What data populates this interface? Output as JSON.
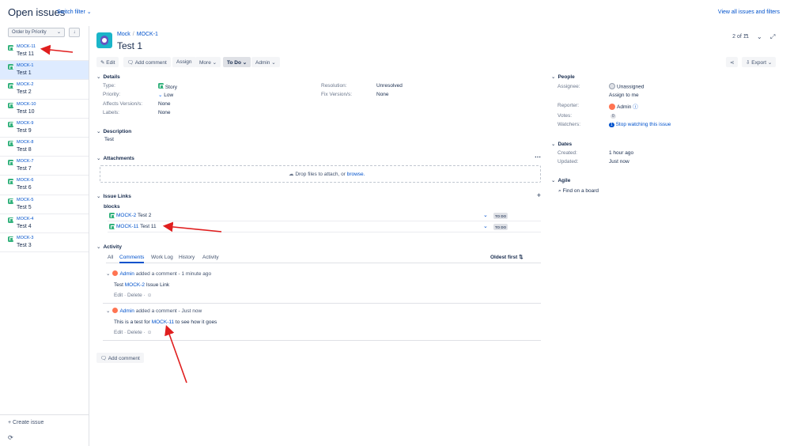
{
  "header": {
    "title": "Open issues",
    "switch_filter": "Switch filter",
    "view_all": "View all issues and filters"
  },
  "sidebar": {
    "order_by": "Order by Priority",
    "sort_icon": "arrow-down-icon",
    "issues": [
      {
        "key": "MOCK-11",
        "summary": "Test 11"
      },
      {
        "key": "MOCK-1",
        "summary": "Test 1"
      },
      {
        "key": "MOCK-2",
        "summary": "Test 2"
      },
      {
        "key": "MOCK-10",
        "summary": "Test 10"
      },
      {
        "key": "MOCK-9",
        "summary": "Test 9"
      },
      {
        "key": "MOCK-8",
        "summary": "Test 8"
      },
      {
        "key": "MOCK-7",
        "summary": "Test 7"
      },
      {
        "key": "MOCK-6",
        "summary": "Test 6"
      },
      {
        "key": "MOCK-5",
        "summary": "Test 5"
      },
      {
        "key": "MOCK-4",
        "summary": "Test 4"
      },
      {
        "key": "MOCK-3",
        "summary": "Test 3"
      }
    ],
    "active_index": 1,
    "create_issue": "Create issue"
  },
  "issue": {
    "project": "Mock",
    "key": "MOCK-1",
    "title": "Test 1",
    "pager": "2 of 11",
    "toolbar": {
      "edit": "Edit",
      "add_comment": "Add comment",
      "assign": "Assign",
      "more": "More",
      "status": "To Do",
      "admin": "Admin",
      "export": "Export"
    },
    "details": {
      "heading": "Details",
      "type_label": "Type:",
      "type_value": "Story",
      "priority_label": "Priority:",
      "priority_value": "Low",
      "affects_label": "Affects Version/s:",
      "affects_value": "None",
      "labels_label": "Labels:",
      "labels_value": "None",
      "resolution_label": "Resolution:",
      "resolution_value": "Unresolved",
      "fix_label": "Fix Version/s:",
      "fix_value": "None"
    },
    "description": {
      "heading": "Description",
      "text": "Test"
    },
    "attachments": {
      "heading": "Attachments",
      "drop_text": "Drop files to attach, or ",
      "browse": "browse."
    },
    "links": {
      "heading": "Issue Links",
      "type": "blocks",
      "items": [
        {
          "key": "MOCK-2",
          "summary": "Test 2",
          "status": "TO DO"
        },
        {
          "key": "MOCK-11",
          "summary": "Test 11",
          "status": "TO DO"
        }
      ]
    },
    "activity": {
      "heading": "Activity",
      "tabs": [
        "All",
        "Comments",
        "Work Log",
        "History",
        "Activity"
      ],
      "active_tab": 1,
      "sort": "Oldest first",
      "comments": [
        {
          "author": "Admin",
          "meta": "added a comment - 1 minute ago",
          "pre": "Test ",
          "link": "MOCK-2",
          "post": " Issue Link"
        },
        {
          "author": "Admin",
          "meta": "added a comment - Just now",
          "pre": "This is a test for ",
          "link": "MOCK-11",
          "post": " to see how it goes"
        }
      ],
      "edit": "Edit",
      "delete": "Delete",
      "add_comment": "Add comment"
    },
    "people": {
      "heading": "People",
      "assignee_label": "Assignee:",
      "assignee_value": "Unassigned",
      "assign_to_me": "Assign to me",
      "reporter_label": "Reporter:",
      "reporter_value": "Admin",
      "votes_label": "Votes:",
      "votes_value": "0",
      "watchers_label": "Watchers:",
      "watchers_count": "1",
      "watchers_value": "Stop watching this issue"
    },
    "dates": {
      "heading": "Dates",
      "created_label": "Created:",
      "created_value": "1 hour ago",
      "updated_label": "Updated:",
      "updated_value": "Just now"
    },
    "agile": {
      "heading": "Agile",
      "find_on_board": "Find on a board"
    }
  },
  "colors": {
    "accent": "#0052cc",
    "story": "#36b37e",
    "annotation_arrow": "#e01e1e",
    "active_row": "#deebff"
  }
}
